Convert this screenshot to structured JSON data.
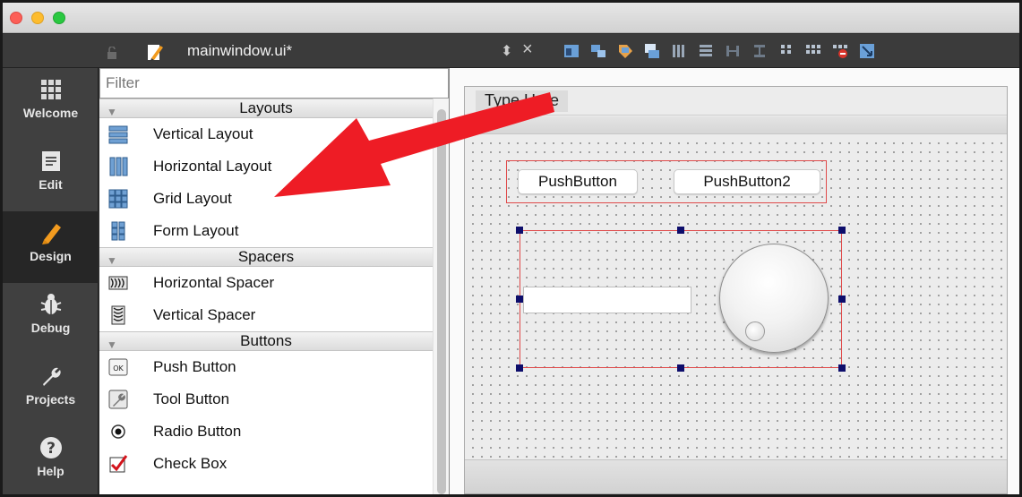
{
  "window": {
    "filename": "mainwindow.ui*"
  },
  "modes": [
    {
      "label": "Welcome",
      "icon": "grid-icon",
      "active": false
    },
    {
      "label": "Edit",
      "icon": "document-icon",
      "active": false
    },
    {
      "label": "Design",
      "icon": "pencil-icon",
      "active": true
    },
    {
      "label": "Debug",
      "icon": "bug-icon",
      "active": false
    },
    {
      "label": "Projects",
      "icon": "wrench-icon",
      "active": false
    },
    {
      "label": "Help",
      "icon": "question-icon",
      "active": false
    }
  ],
  "widget_box": {
    "filter_placeholder": "Filter",
    "categories": [
      {
        "title": "Layouts",
        "items": [
          {
            "label": "Vertical Layout",
            "icon": "vertical-layout-icon"
          },
          {
            "label": "Horizontal Layout",
            "icon": "horizontal-layout-icon"
          },
          {
            "label": "Grid Layout",
            "icon": "grid-layout-icon"
          },
          {
            "label": "Form Layout",
            "icon": "form-layout-icon"
          }
        ]
      },
      {
        "title": "Spacers",
        "items": [
          {
            "label": "Horizontal Spacer",
            "icon": "horizontal-spacer-icon"
          },
          {
            "label": "Vertical Spacer",
            "icon": "vertical-spacer-icon"
          }
        ]
      },
      {
        "title": "Buttons",
        "items": [
          {
            "label": "Push Button",
            "icon": "push-button-icon"
          },
          {
            "label": "Tool Button",
            "icon": "tool-button-icon"
          },
          {
            "label": "Radio Button",
            "icon": "radio-button-icon"
          },
          {
            "label": "Check Box",
            "icon": "check-box-icon"
          }
        ]
      }
    ]
  },
  "form": {
    "menu_placeholder": "Type Here",
    "buttons": [
      "PushButton",
      "PushButton2"
    ]
  },
  "colors": {
    "annotation_arrow": "#ee1c25",
    "layout_border": "#e04a4a",
    "selection_handle": "#0d0d6b"
  }
}
